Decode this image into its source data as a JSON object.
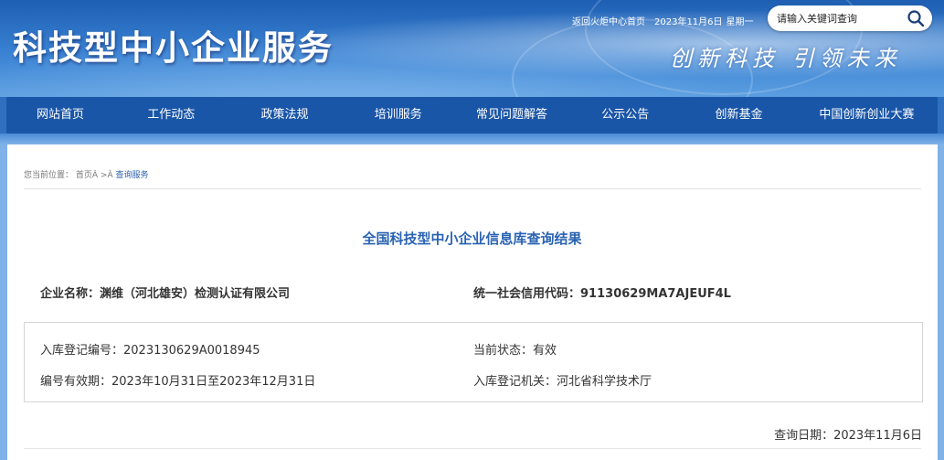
{
  "header": {
    "site_title": "科技型中小企业服务",
    "slogan": "创新科技 引领未来",
    "top_links": {
      "home_link": "返回火炬中心首页",
      "date": "2023年11月6日",
      "weekday": "星期一"
    },
    "search": {
      "value": "请输入关键词查询",
      "placeholder": "请输入关键词查询"
    }
  },
  "nav": {
    "items": [
      "网站首页",
      "工作动态",
      "政策法规",
      "培训服务",
      "常见问题解答",
      "公示公告",
      "创新基金",
      "中国创新创业大赛"
    ]
  },
  "breadcrumb": {
    "prefix": "您当前位置：",
    "home": "首页Â",
    "separator": " >Â ",
    "current": "查询服务"
  },
  "result": {
    "title": "全国科技型中小企业信息库查询结果",
    "company_name_label": "企业名称：",
    "company_name": "渊维（河北雄安）检测认证有限公司",
    "credit_code_label": "统一社会信用代码：",
    "credit_code": "91130629MA7AJEUF4L",
    "registration_no_label": "入库登记编号：",
    "registration_no": "2023130629A0018945",
    "status_label": "当前状态：",
    "status": "有效",
    "validity_label": "编号有效期：",
    "validity": "2023年10月31日至2023年12月31日",
    "authority_label": "入库登记机关：",
    "authority": "河北省科学技术厅",
    "query_date_label": "查询日期：",
    "query_date": "2023年11月6日"
  },
  "colors": {
    "nav_bg": "#1a56a8",
    "title_blue": "#2a63b3",
    "banner_blue": "#1e5fb3"
  },
  "icons": {
    "search": "search-icon"
  }
}
